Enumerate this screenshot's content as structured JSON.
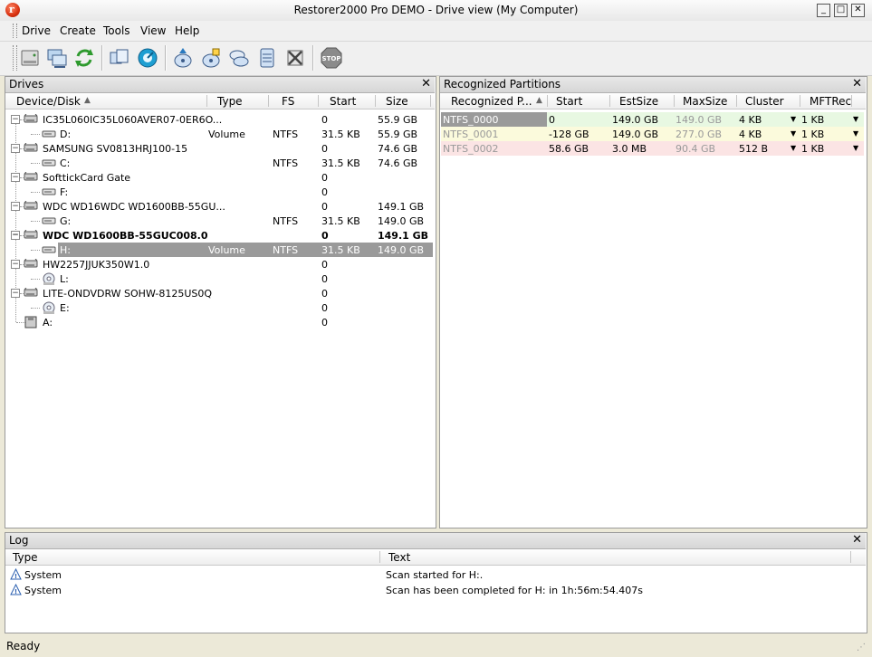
{
  "window": {
    "title": "Restorer2000 Pro DEMO - Drive view (My Computer)",
    "app_icon_glyph": "r"
  },
  "menu": [
    "Drive",
    "Create",
    "Tools",
    "View",
    "Help"
  ],
  "toolbar": {
    "icons": [
      "local-disks-icon",
      "network-disks-icon",
      "refresh-icon",
      "open-image-icon",
      "scan-icon",
      "create-image-icon",
      "create-region-icon",
      "create-virtual-raid-icon",
      "create-partition-icon",
      "remove-icon",
      "stop-icon"
    ],
    "stop_label": "STOP"
  },
  "drives_panel": {
    "title": "Drives",
    "columns": [
      "Device/Disk",
      "Type",
      "FS",
      "Start",
      "Size"
    ],
    "rows": [
      {
        "name": "IC35L060IC35L060AVER07-0ER6O...",
        "type": "",
        "fs": "",
        "start": "0",
        "size": "55.9 GB",
        "level": 0,
        "kind": "disk",
        "bold": false,
        "selected": false
      },
      {
        "name": "D:",
        "type": "Volume",
        "fs": "NTFS",
        "start": "31.5 KB",
        "size": "55.9 GB",
        "level": 1,
        "kind": "part",
        "bold": false,
        "selected": false
      },
      {
        "name": "SAMSUNG SV0813HRJ100-15",
        "type": "",
        "fs": "",
        "start": "0",
        "size": "74.6 GB",
        "level": 0,
        "kind": "disk",
        "bold": false,
        "selected": false
      },
      {
        "name": "C:",
        "type": "",
        "fs": "NTFS",
        "start": "31.5 KB",
        "size": "74.6 GB",
        "level": 1,
        "kind": "part",
        "bold": false,
        "selected": false
      },
      {
        "name": "SofttickCard Gate",
        "type": "",
        "fs": "",
        "start": "0",
        "size": "",
        "level": 0,
        "kind": "disk",
        "bold": false,
        "selected": false
      },
      {
        "name": "F:",
        "type": "",
        "fs": "",
        "start": "0",
        "size": "",
        "level": 1,
        "kind": "part",
        "bold": false,
        "selected": false
      },
      {
        "name": "WDC WD16WDC WD1600BB-55GU...",
        "type": "",
        "fs": "",
        "start": "0",
        "size": "149.1 GB",
        "level": 0,
        "kind": "disk",
        "bold": false,
        "selected": false
      },
      {
        "name": "G:",
        "type": "",
        "fs": "NTFS",
        "start": "31.5 KB",
        "size": "149.0 GB",
        "level": 1,
        "kind": "part",
        "bold": false,
        "selected": false
      },
      {
        "name": "WDC WD1600BB-55GUC008.0",
        "type": "",
        "fs": "",
        "start": "0",
        "size": "149.1 GB",
        "level": 0,
        "kind": "disk",
        "bold": true,
        "selected": false
      },
      {
        "name": "H:",
        "type": "Volume",
        "fs": "NTFS",
        "start": "31.5 KB",
        "size": "149.0 GB",
        "level": 1,
        "kind": "part",
        "bold": false,
        "selected": true
      },
      {
        "name": "HW2257JJUK350W1.0",
        "type": "",
        "fs": "",
        "start": "0",
        "size": "",
        "level": 0,
        "kind": "disk",
        "bold": false,
        "selected": false
      },
      {
        "name": "L:",
        "type": "",
        "fs": "",
        "start": "0",
        "size": "",
        "level": 1,
        "kind": "cd",
        "bold": false,
        "selected": false
      },
      {
        "name": "LITE-ONDVDRW SOHW-8125US0Q",
        "type": "",
        "fs": "",
        "start": "0",
        "size": "",
        "level": 0,
        "kind": "disk",
        "bold": false,
        "selected": false
      },
      {
        "name": "E:",
        "type": "",
        "fs": "",
        "start": "0",
        "size": "",
        "level": 1,
        "kind": "cd",
        "bold": false,
        "selected": false
      },
      {
        "name": "A:",
        "type": "",
        "fs": "",
        "start": "0",
        "size": "",
        "level": 0,
        "kind": "floppy",
        "bold": false,
        "selected": false
      }
    ]
  },
  "partitions_panel": {
    "title": "Recognized Partitions",
    "columns": [
      "Recognized P...",
      "Start",
      "EstSize",
      "MaxSize",
      "Cluster",
      "MFTRec"
    ],
    "rows": [
      {
        "name": "NTFS_0000",
        "start": "0",
        "estsize": "149.0 GB",
        "maxsize": "149.0 GB",
        "cluster": "4 KB",
        "mftrec": "1 KB",
        "color": "#e8f8e2",
        "selected": true
      },
      {
        "name": "NTFS_0001",
        "start": "-128 GB",
        "estsize": "149.0 GB",
        "maxsize": "277.0 GB",
        "cluster": "4 KB",
        "mftrec": "1 KB",
        "color": "#fbfadc",
        "selected": false
      },
      {
        "name": "NTFS_0002",
        "start": "58.6 GB",
        "estsize": "3.0 MB",
        "maxsize": "90.4 GB",
        "cluster": "512 B",
        "mftrec": "1 KB",
        "color": "#fbe4e4",
        "selected": false
      }
    ]
  },
  "log_panel": {
    "title": "Log",
    "columns": [
      "Type",
      "Text"
    ],
    "rows": [
      {
        "type": "System",
        "text": "Scan started for H:."
      },
      {
        "type": "System",
        "text": "Scan has been completed for H: in 1h:56m:54.407s"
      }
    ]
  },
  "status": {
    "text": "Ready"
  }
}
